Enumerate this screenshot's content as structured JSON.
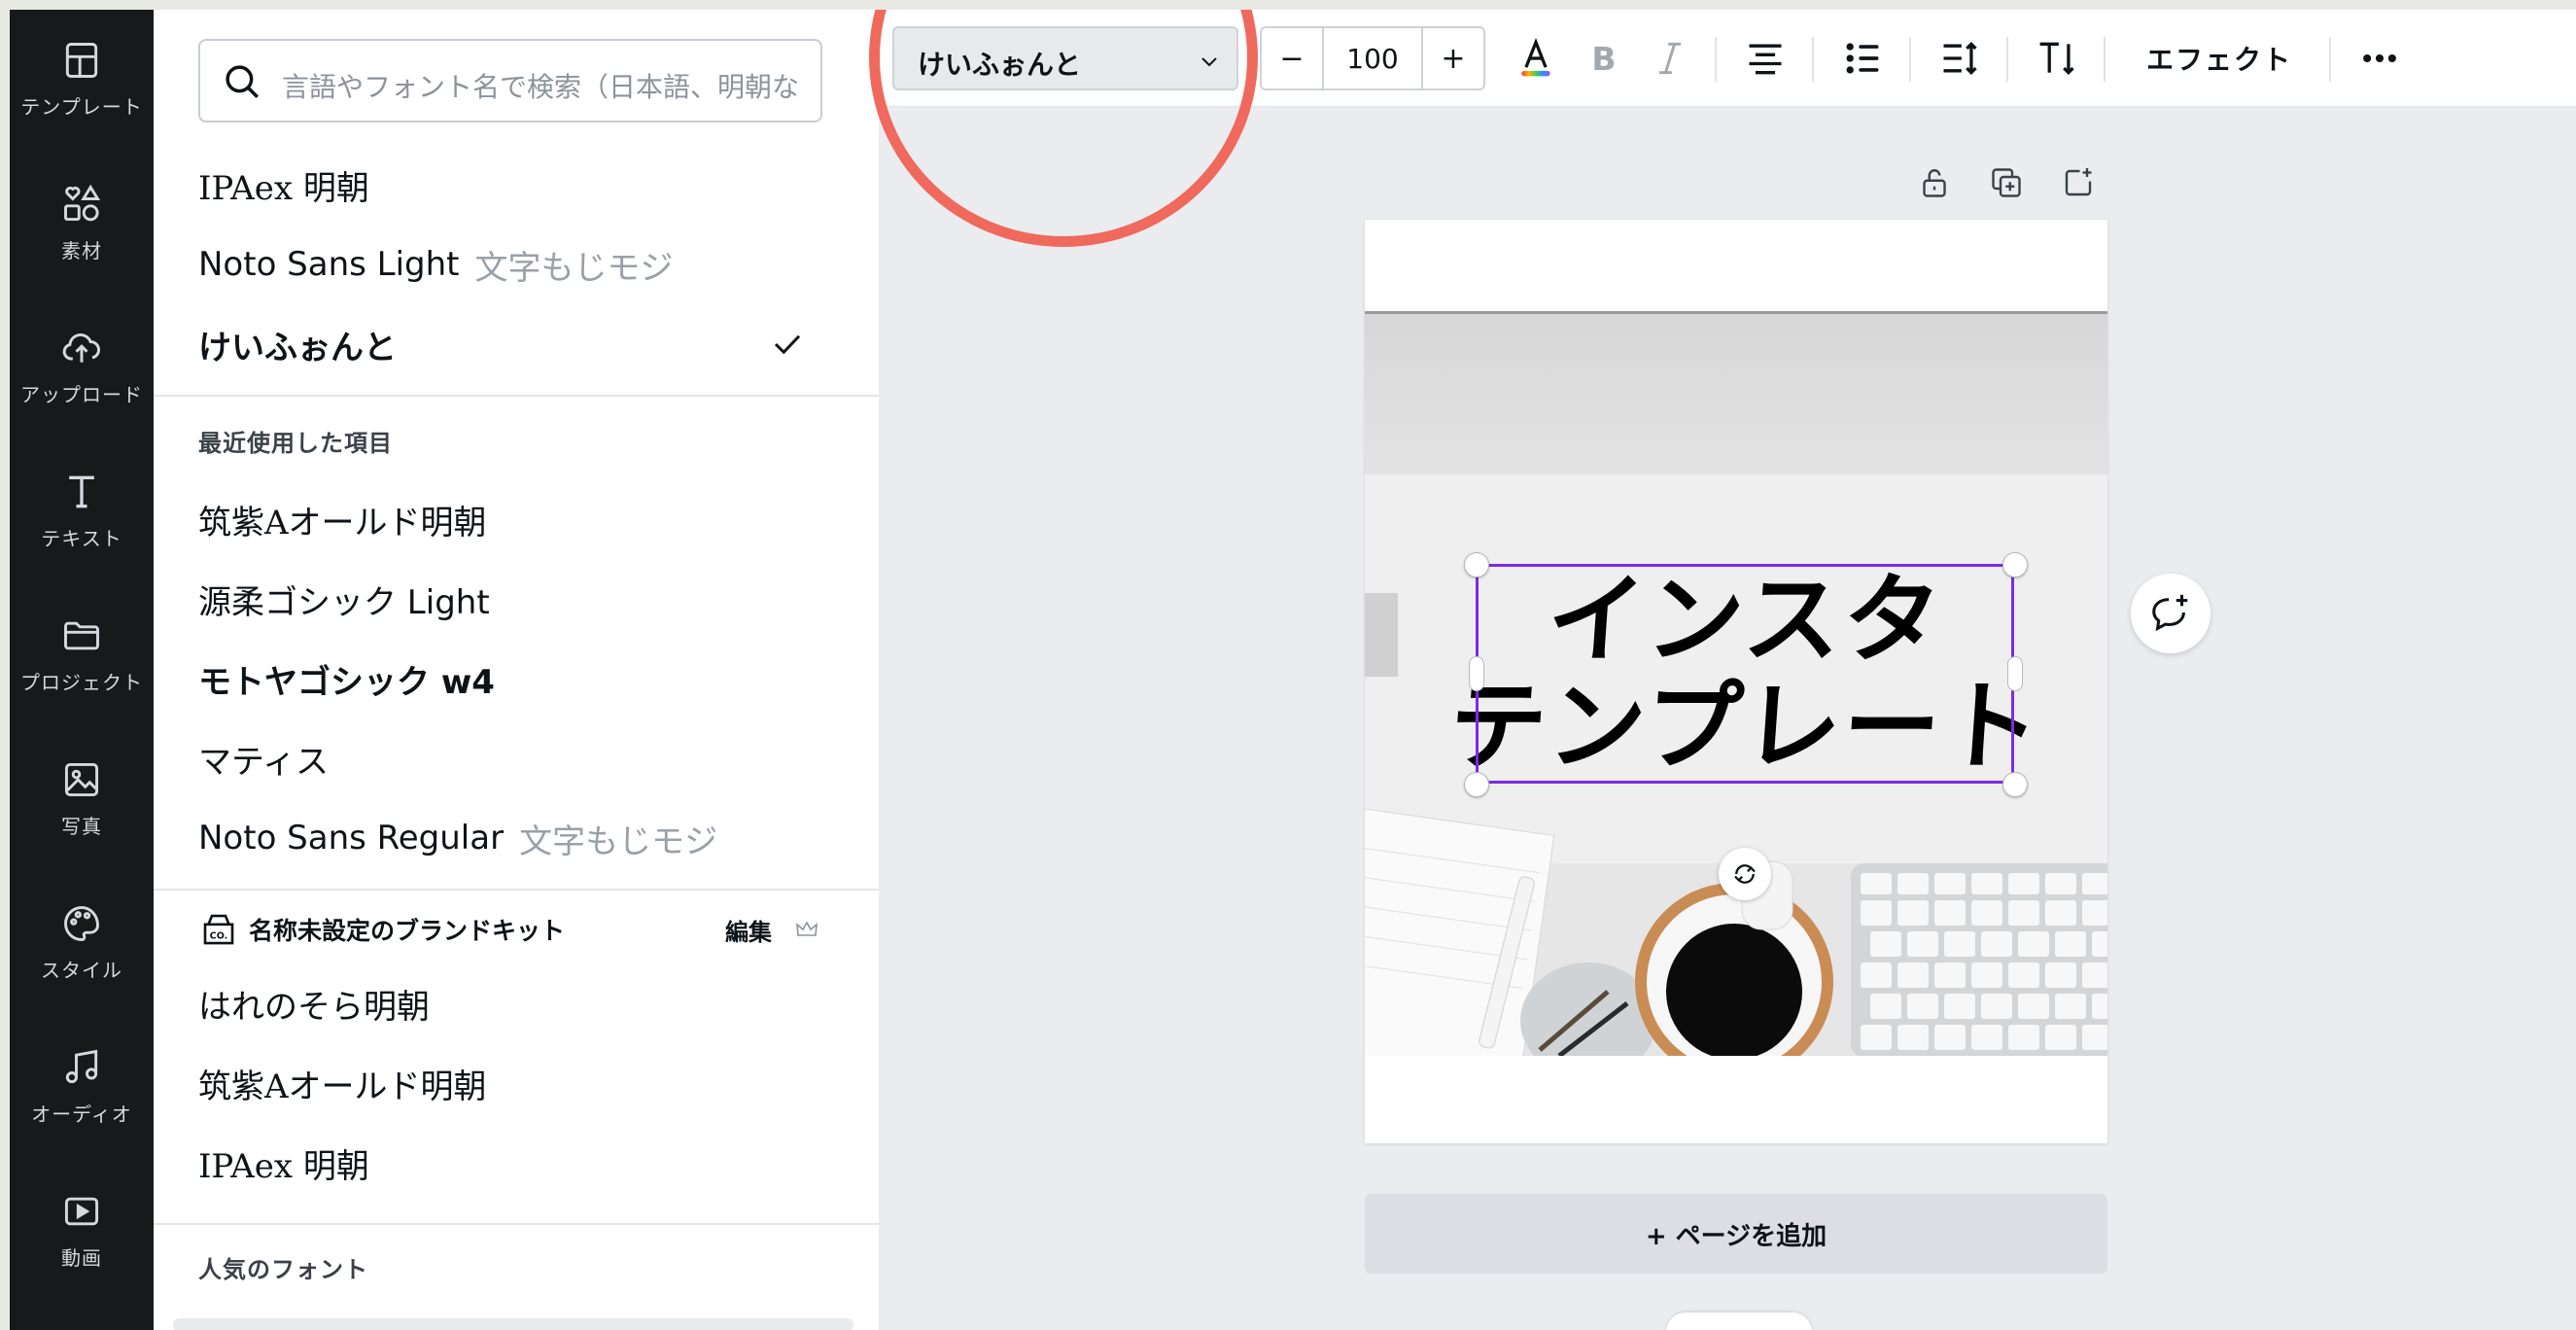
{
  "sidebar": {
    "items": [
      {
        "label": "テンプレート",
        "icon": "template-icon"
      },
      {
        "label": "素材",
        "icon": "elements-icon"
      },
      {
        "label": "アップロード",
        "icon": "cloud-upload-icon"
      },
      {
        "label": "テキスト",
        "icon": "text-icon"
      },
      {
        "label": "プロジェクト",
        "icon": "folder-icon"
      },
      {
        "label": "写真",
        "icon": "photo-icon"
      },
      {
        "label": "スタイル",
        "icon": "palette-icon"
      },
      {
        "label": "オーディオ",
        "icon": "music-note-icon"
      },
      {
        "label": "動画",
        "icon": "video-icon"
      }
    ]
  },
  "font_panel": {
    "search_placeholder": "言語やフォント名で検索（日本語、明朝な",
    "top_fonts": [
      {
        "name": "IPAex 明朝",
        "sample": ""
      },
      {
        "name": "Noto Sans Light",
        "sample": "文字もじモジ"
      },
      {
        "name": "けいふぉんと",
        "sample": "",
        "selected": true
      }
    ],
    "recent_heading": "最近使用した項目",
    "recent_fonts": [
      {
        "name": "筑紫Aオールド明朝",
        "sample": ""
      },
      {
        "name": "源柔ゴシック Light",
        "sample": ""
      },
      {
        "name": "モトヤゴシック w4",
        "sample": ""
      },
      {
        "name": "マティス",
        "sample": ""
      },
      {
        "name": "Noto Sans Regular",
        "sample": "文字もじモジ"
      }
    ],
    "brand_kit": {
      "name": "名称未設定のブランドキット",
      "edit_label": "編集",
      "fonts": [
        "はれのそら明朝",
        "筑紫Aオールド明朝",
        "IPAex 明朝"
      ]
    },
    "popular_heading": "人気のフォント"
  },
  "toolbar": {
    "font_name": "けいふぉんと",
    "font_size": "100",
    "minus_label": "−",
    "plus_label": "+",
    "effect_label": "エフェクト",
    "icons": [
      "text-color-icon",
      "bold-icon",
      "italic-icon",
      "align-center-icon",
      "list-icon",
      "line-spacing-icon",
      "text-direction-icon",
      "more-icon"
    ]
  },
  "canvas": {
    "text_lines": [
      "インスタ",
      "テンプレート"
    ],
    "add_page_label": "+ ページを追加"
  },
  "colors": {
    "rail_bg": "#18191b",
    "selection": "#7d2ae8",
    "highlight_circle": "#ef6a5c"
  }
}
